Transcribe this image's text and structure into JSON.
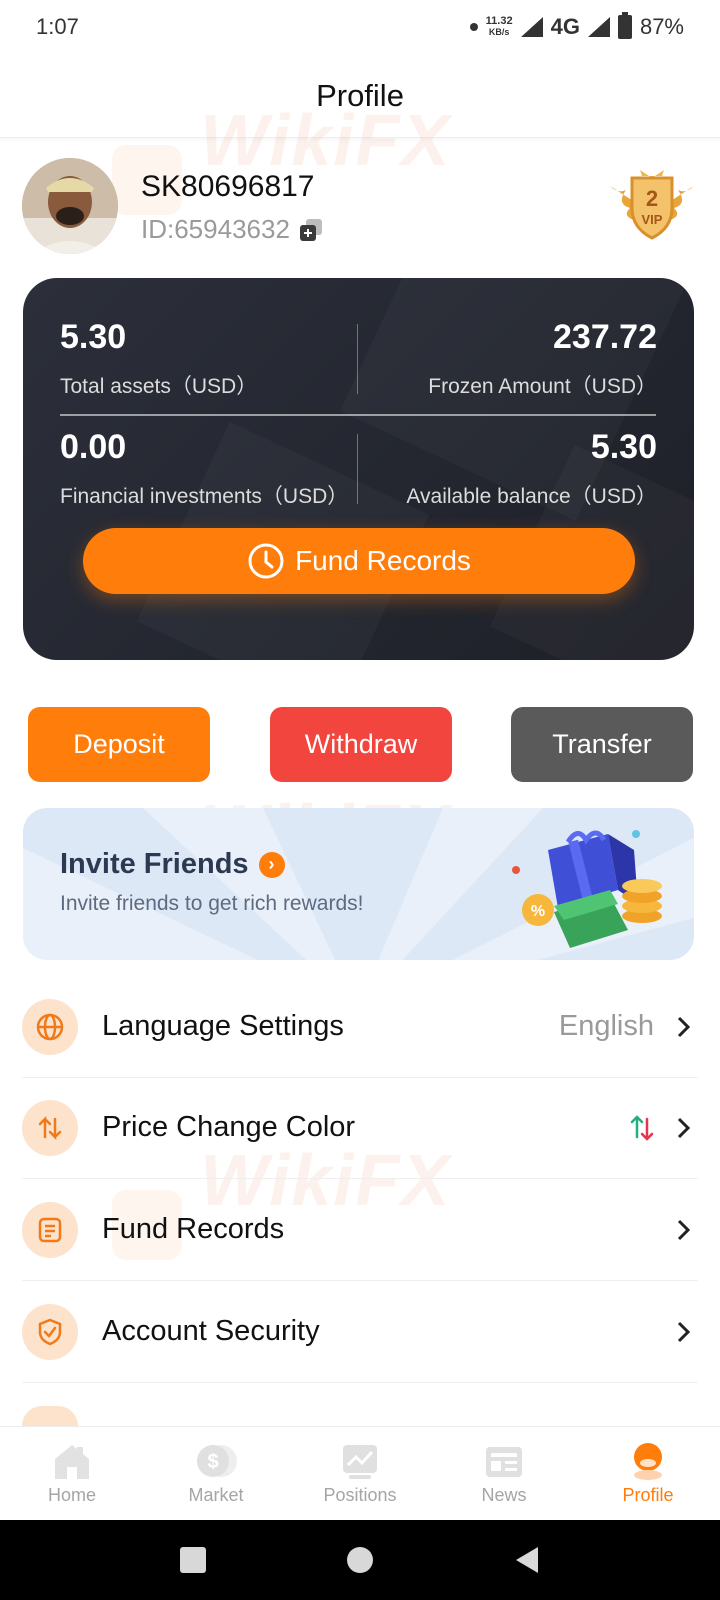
{
  "status_bar": {
    "time": "1:07",
    "net_speed_value": "11.32",
    "net_speed_unit": "KB/s",
    "network": "4G",
    "battery": "87%"
  },
  "header": {
    "title": "Profile"
  },
  "profile": {
    "username": "SK80696817",
    "id_text": "ID:65943632",
    "vip_level": "2",
    "vip_label": "VIP"
  },
  "assets": {
    "total_assets_value": "5.30",
    "total_assets_label": "Total assets（USD）",
    "frozen_value": "237.72",
    "frozen_label": "Frozen Amount（USD）",
    "financial_value": "0.00",
    "financial_label": "Financial investments（USD）",
    "available_value": "5.30",
    "available_label": "Available balance（USD）",
    "fund_records_button": "Fund Records"
  },
  "actions": {
    "deposit": "Deposit",
    "withdraw": "Withdraw",
    "transfer": "Transfer"
  },
  "invite": {
    "title": "Invite Friends",
    "subtitle": "Invite friends to get rich rewards!"
  },
  "menu": [
    {
      "label": "Language Settings",
      "value": "English"
    },
    {
      "label": "Price Change Color",
      "value": ""
    },
    {
      "label": "Fund Records",
      "value": ""
    },
    {
      "label": "Account Security",
      "value": ""
    }
  ],
  "bottom_nav": [
    {
      "label": "Home"
    },
    {
      "label": "Market"
    },
    {
      "label": "Positions"
    },
    {
      "label": "News"
    },
    {
      "label": "Profile"
    }
  ],
  "watermark": "WikiFX",
  "colors": {
    "accent": "#ff7d0a",
    "withdraw": "#f2453d",
    "transfer": "#5a5a5a",
    "card_bg": "#2c2f3a"
  }
}
